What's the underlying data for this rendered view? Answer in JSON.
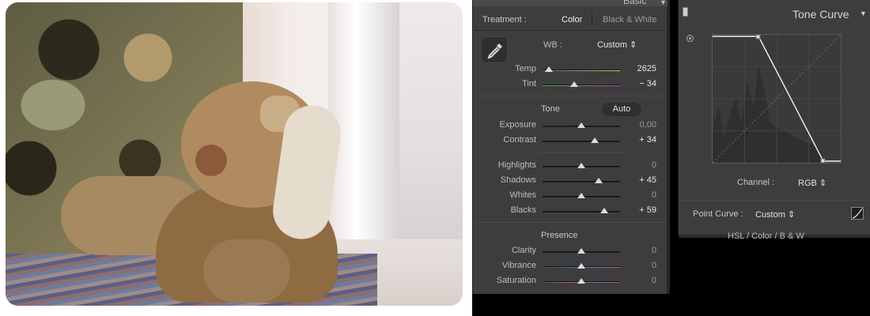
{
  "basic_panel": {
    "header": "Basic",
    "treatment_label": "Treatment :",
    "treatment_color": "Color",
    "treatment_bw": "Black & White",
    "wb_label": "WB :",
    "wb_value": "Custom",
    "temp": {
      "label": "Temp",
      "value": "2625",
      "level": 0.08
    },
    "tint": {
      "label": "Tint",
      "value": "− 34",
      "level": 0.41
    },
    "tone_label": "Tone",
    "auto_label": "Auto",
    "exposure": {
      "label": "Exposure",
      "value": "0,00",
      "level": 0.5
    },
    "contrast": {
      "label": "Contrast",
      "value": "+ 34",
      "level": 0.67
    },
    "highlights": {
      "label": "Highlights",
      "value": "0",
      "level": 0.5
    },
    "shadows": {
      "label": "Shadows",
      "value": "+ 45",
      "level": 0.72
    },
    "whites": {
      "label": "Whites",
      "value": "0",
      "level": 0.5
    },
    "blacks": {
      "label": "Blacks",
      "value": "+ 59",
      "level": 0.8
    },
    "presence_label": "Presence",
    "clarity": {
      "label": "Clarity",
      "value": "0",
      "level": 0.5
    },
    "vibrance": {
      "label": "Vibrance",
      "value": "0",
      "level": 0.5
    },
    "saturation": {
      "label": "Saturation",
      "value": "0",
      "level": 0.5
    }
  },
  "tone_curve": {
    "title": "Tone Curve",
    "channel_label": "Channel :",
    "channel_value": "RGB",
    "point_curve_label": "Point Curve :",
    "point_curve_value": "Custom",
    "next_panel_header": "HSL / Color / B & W"
  },
  "colors": {
    "panel_bg": "#3d3d3d",
    "track_temp_left": "#3b6cd6",
    "track_temp_right": "#e8c23a",
    "track_tint_left": "#3fb83f",
    "track_tint_right": "#c040c0"
  }
}
